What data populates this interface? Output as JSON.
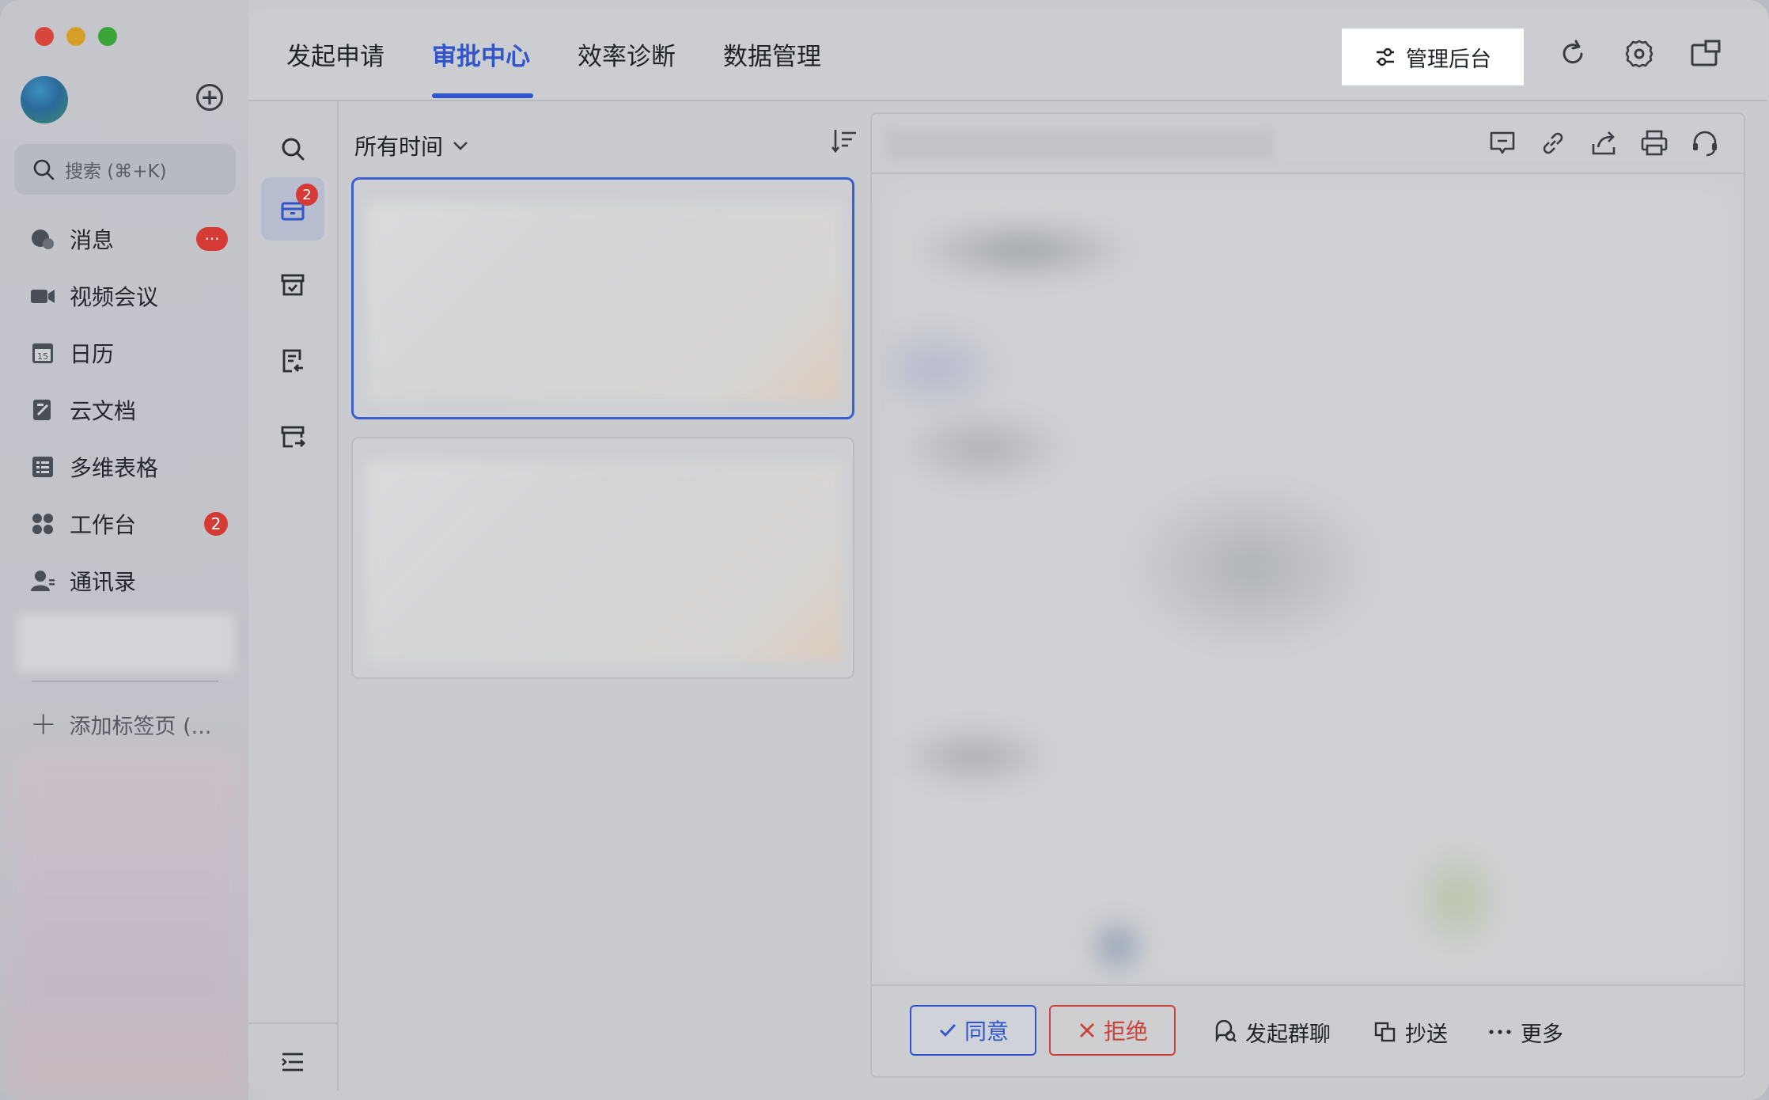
{
  "sidebar": {
    "search_placeholder": "搜索 (⌘+K)",
    "items": [
      {
        "label": "消息",
        "icon": "chat-bubble-icon",
        "badge": "···"
      },
      {
        "label": "视频会议",
        "icon": "video-camera-icon",
        "badge": ""
      },
      {
        "label": "日历",
        "icon": "calendar-icon",
        "badge": ""
      },
      {
        "label": "云文档",
        "icon": "document-icon",
        "badge": ""
      },
      {
        "label": "多维表格",
        "icon": "table-icon",
        "badge": ""
      },
      {
        "label": "工作台",
        "icon": "apps-grid-icon",
        "badge": "2"
      },
      {
        "label": "通讯录",
        "icon": "contacts-icon",
        "badge": ""
      }
    ],
    "add_tab_label": "添加标签页 (..."
  },
  "topbar": {
    "tabs": [
      "发起申请",
      "审批中心",
      "效率诊断",
      "数据管理"
    ],
    "active_tab": "审批中心",
    "admin_label": "管理后台"
  },
  "rail": {
    "pending_badge": "2"
  },
  "list": {
    "filter_label": "所有时间"
  },
  "actions": {
    "approve": "同意",
    "reject": "拒绝",
    "group_chat": "发起群聊",
    "cc": "抄送",
    "more": "更多"
  },
  "colors": {
    "accent": "#2f55c8",
    "danger": "#c8433a",
    "badge": "#d53a34"
  }
}
